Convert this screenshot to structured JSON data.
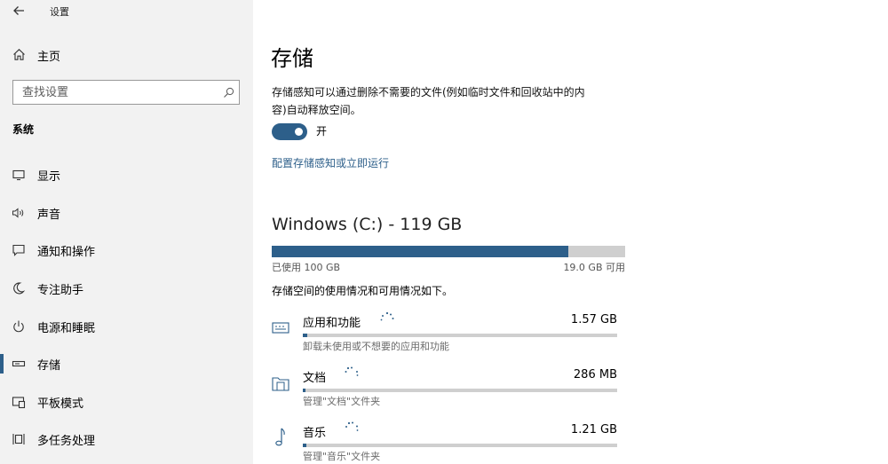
{
  "colors": {
    "accent": "#2d5f8a",
    "sidebar_bg": "#f2f2f2",
    "track": "#cfcfcf",
    "link": "#2d5f8a"
  },
  "window": {
    "title": "设置",
    "back_icon": "back-arrow-icon"
  },
  "sidebar": {
    "home_label": "主页",
    "search_placeholder": "查找设置",
    "section_title": "系统",
    "items": [
      {
        "label": "显示",
        "icon": "display-icon",
        "selected": false
      },
      {
        "label": "声音",
        "icon": "speaker-icon",
        "selected": false
      },
      {
        "label": "通知和操作",
        "icon": "notification-icon",
        "selected": false
      },
      {
        "label": "专注助手",
        "icon": "moon-icon",
        "selected": false
      },
      {
        "label": "电源和睡眠",
        "icon": "power-icon",
        "selected": false
      },
      {
        "label": "存储",
        "icon": "storage-icon",
        "selected": true
      },
      {
        "label": "平板模式",
        "icon": "tablet-icon",
        "selected": false
      },
      {
        "label": "多任务处理",
        "icon": "multitask-icon",
        "selected": false
      }
    ]
  },
  "main": {
    "title": "存储",
    "description_line1": "存储感知可以通过删除不需要的文件(例如临时文件和回收站中的内",
    "description_line2": "容)自动释放空间。",
    "toggle": {
      "on": true,
      "label": "开"
    },
    "configure_link": "配置存储感知或立即运行",
    "drive": {
      "title": "Windows (C:) - 119 GB",
      "used_label": "已使用 100 GB",
      "free_label": "19.0 GB 可用",
      "used_fraction": 0.84
    },
    "usage_intro": "存储空间的使用情况和可用情况如下。",
    "categories": [
      {
        "name": "应用和功能",
        "size": "1.57 GB",
        "sub": "卸载未使用或不想要的应用和功能",
        "icon": "keyboard-icon",
        "fraction": 0.015
      },
      {
        "name": "文档",
        "size": "286 MB",
        "sub": "管理\"文档\"文件夹",
        "icon": "documents-folder-icon",
        "fraction": 0.008
      },
      {
        "name": "音乐",
        "size": "1.21 GB",
        "sub": "管理\"音乐\"文件夹",
        "icon": "music-note-icon",
        "fraction": 0.012
      }
    ]
  }
}
